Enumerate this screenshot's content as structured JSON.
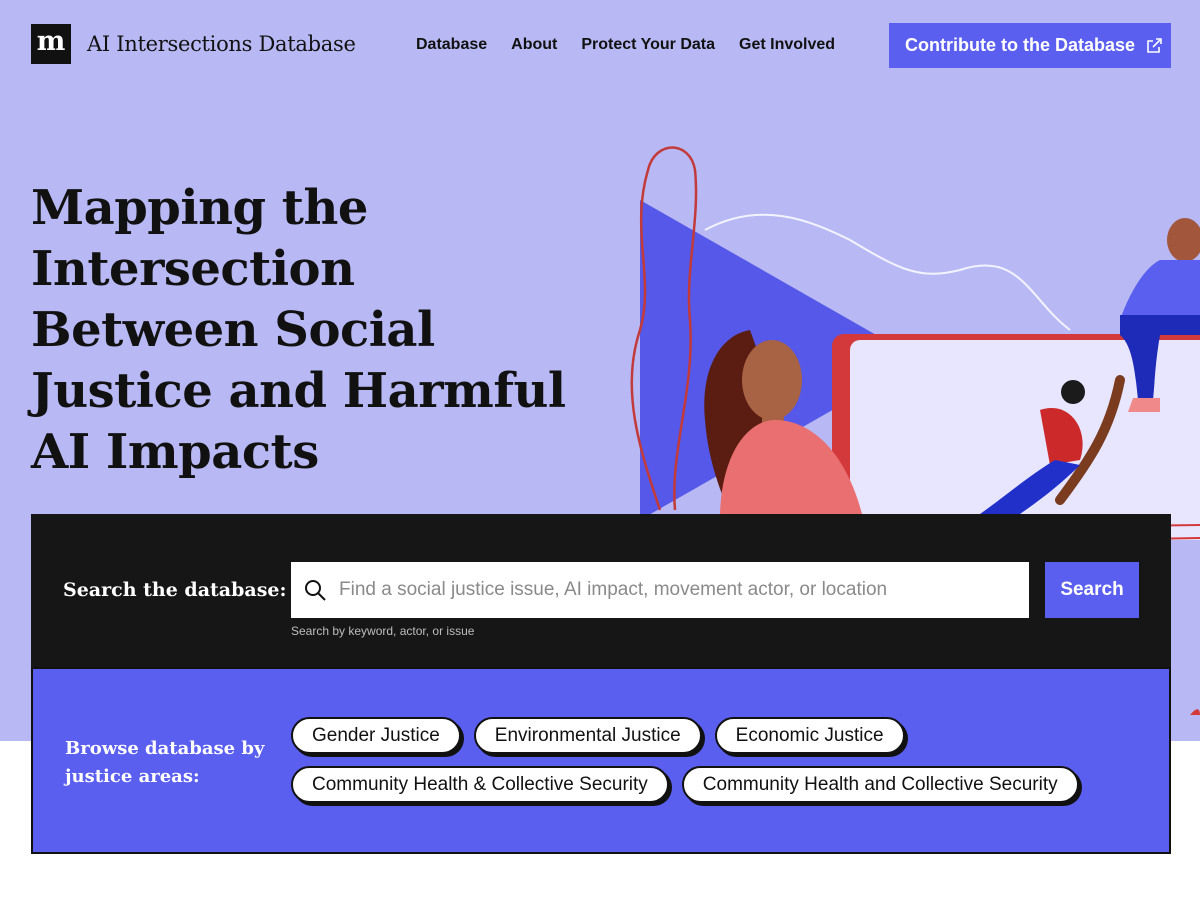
{
  "header": {
    "logo_text": "m",
    "site_title": "AI Intersections Database",
    "nav": [
      "Database",
      "About",
      "Protect Your Data",
      "Get Involved"
    ],
    "cta_label": "Contribute to the Database"
  },
  "hero": {
    "headline": "Mapping the Intersection Between Social Justice and Harmful AI Impacts"
  },
  "search": {
    "label": "Search the database:",
    "placeholder": "Find a social justice issue, AI impact, movement actor, or location",
    "hint": "Search by keyword, actor, or issue",
    "button_label": "Search"
  },
  "browse": {
    "label": "Browse database by justice areas:",
    "tags": [
      "Gender Justice",
      "Environmental Justice",
      "Economic Justice",
      "Community Health & Collective Security",
      "Community Health and Collective Security"
    ]
  },
  "colors": {
    "hero_bg": "#b8b9f4",
    "accent": "#5b5ff0",
    "dark": "#161616"
  },
  "icons": [
    "external-link-icon",
    "search-icon"
  ]
}
